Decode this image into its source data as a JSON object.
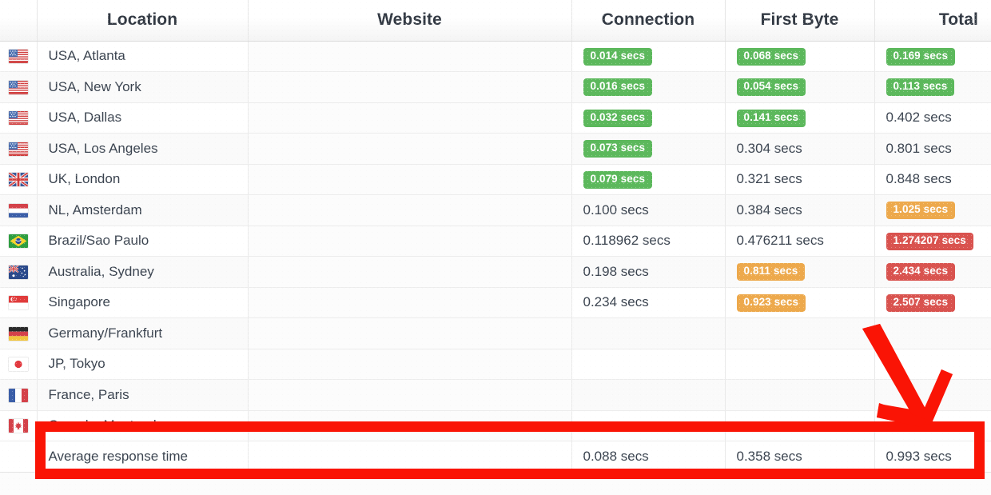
{
  "table": {
    "columns": [
      {
        "key": "flag",
        "label": ""
      },
      {
        "key": "loc",
        "label": "Location"
      },
      {
        "key": "site",
        "label": "Website"
      },
      {
        "key": "conn",
        "label": "Connection"
      },
      {
        "key": "fb",
        "label": "First Byte"
      },
      {
        "key": "total",
        "label": "Total"
      }
    ],
    "rows": [
      {
        "flag": "us",
        "flag_name": "flag-usa",
        "location": "USA, Atlanta",
        "website": "",
        "connection": "0.014 secs",
        "connection_state": "good",
        "first_byte": "0.068 secs",
        "first_byte_state": "good",
        "total": "0.169 secs",
        "total_state": "good"
      },
      {
        "flag": "us",
        "flag_name": "flag-usa",
        "location": "USA, New York",
        "website": "",
        "connection": "0.016 secs",
        "connection_state": "good",
        "first_byte": "0.054 secs",
        "first_byte_state": "good",
        "total": "0.113 secs",
        "total_state": "good"
      },
      {
        "flag": "us",
        "flag_name": "flag-usa",
        "location": "USA, Dallas",
        "website": "",
        "connection": "0.032 secs",
        "connection_state": "good",
        "first_byte": "0.141 secs",
        "first_byte_state": "good",
        "total": "0.402 secs",
        "total_state": "plain"
      },
      {
        "flag": "us",
        "flag_name": "flag-usa",
        "location": "USA, Los Angeles",
        "website": "",
        "connection": "0.073 secs",
        "connection_state": "good",
        "first_byte": "0.304 secs",
        "first_byte_state": "plain",
        "total": "0.801 secs",
        "total_state": "plain"
      },
      {
        "flag": "uk",
        "flag_name": "flag-united-kingdom",
        "location": "UK, London",
        "website": "",
        "connection": "0.079 secs",
        "connection_state": "good",
        "first_byte": "0.321 secs",
        "first_byte_state": "plain",
        "total": "0.848 secs",
        "total_state": "plain"
      },
      {
        "flag": "nl",
        "flag_name": "flag-netherlands",
        "location": "NL, Amsterdam",
        "website": "",
        "connection": "0.100 secs",
        "connection_state": "plain",
        "first_byte": "0.384 secs",
        "first_byte_state": "plain",
        "total": "1.025 secs",
        "total_state": "warn"
      },
      {
        "flag": "br",
        "flag_name": "flag-brazil",
        "location": "Brazil/Sao Paulo",
        "website": "",
        "connection": "0.118962 secs",
        "connection_state": "plain",
        "first_byte": "0.476211 secs",
        "first_byte_state": "plain",
        "total": "1.274207 secs",
        "total_state": "bad"
      },
      {
        "flag": "au",
        "flag_name": "flag-australia",
        "location": "Australia, Sydney",
        "website": "",
        "connection": "0.198 secs",
        "connection_state": "plain",
        "first_byte": "0.811 secs",
        "first_byte_state": "warn",
        "total": "2.434 secs",
        "total_state": "bad"
      },
      {
        "flag": "sg",
        "flag_name": "flag-singapore",
        "location": "Singapore",
        "website": "",
        "connection": "0.234 secs",
        "connection_state": "plain",
        "first_byte": "0.923 secs",
        "first_byte_state": "warn",
        "total": "2.507 secs",
        "total_state": "bad"
      },
      {
        "flag": "de",
        "flag_name": "flag-germany",
        "location": "Germany/Frankfurt",
        "website": "",
        "connection": "",
        "connection_state": "plain",
        "first_byte": "",
        "first_byte_state": "plain",
        "total": "",
        "total_state": "plain"
      },
      {
        "flag": "jp",
        "flag_name": "flag-japan",
        "location": "JP, Tokyo",
        "website": "",
        "connection": "",
        "connection_state": "plain",
        "first_byte": "",
        "first_byte_state": "plain",
        "total": "",
        "total_state": "plain"
      },
      {
        "flag": "fr",
        "flag_name": "flag-france",
        "location": "France, Paris",
        "website": "",
        "connection": "",
        "connection_state": "plain",
        "first_byte": "",
        "first_byte_state": "plain",
        "total": "",
        "total_state": "plain"
      },
      {
        "flag": "ca",
        "flag_name": "flag-canada",
        "location": "Canada, Montreal",
        "website": "",
        "connection": "",
        "connection_state": "plain",
        "first_byte": "",
        "first_byte_state": "plain",
        "total": "",
        "total_state": "plain"
      }
    ],
    "average_row": {
      "label": "Average response time",
      "website": "",
      "connection": "0.088 secs",
      "first_byte": "0.358 secs",
      "total": "0.993 secs"
    }
  },
  "annotations": {
    "highlight_box": {
      "name": "red-highlight-box",
      "color": "#fa1405"
    },
    "arrow": {
      "name": "red-arrow-annotation",
      "color": "#fa1405",
      "points_at": "average response time total"
    }
  },
  "colors": {
    "good": "#5cb85c",
    "warn": "#eda94c",
    "bad": "#d9534f",
    "text": "#3b4450",
    "header_text": "#333a44",
    "annotation": "#fa1405"
  }
}
